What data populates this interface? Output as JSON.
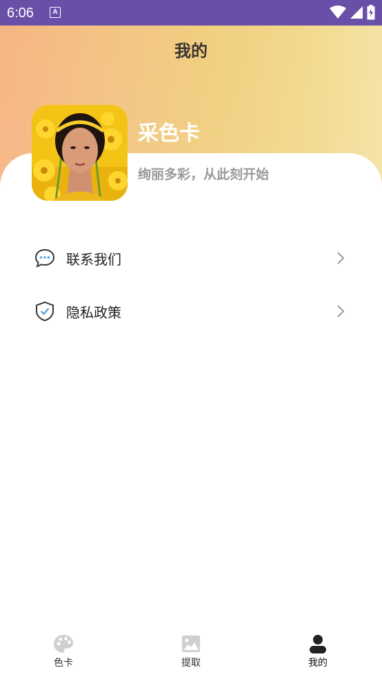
{
  "status_bar": {
    "time": "6:06",
    "notification_letter": "A"
  },
  "header": {
    "title": "我的"
  },
  "profile": {
    "app_name": "采色卡",
    "slogan": "绚丽多彩，从此刻开始"
  },
  "menu": [
    {
      "label": "联系我们",
      "icon": "chat-bubble-icon"
    },
    {
      "label": "隐私政策",
      "icon": "shield-check-icon"
    }
  ],
  "bottom_nav": [
    {
      "label": "色卡",
      "icon": "palette-icon",
      "active": false
    },
    {
      "label": "提取",
      "icon": "image-icon",
      "active": false
    },
    {
      "label": "我的",
      "icon": "person-icon",
      "active": true
    }
  ],
  "colors": {
    "status_bar": "#6a4fa8",
    "accent": "#5aa7e0",
    "header_gradient_start": "#f7b583",
    "header_gradient_end": "#f5e2a4"
  }
}
